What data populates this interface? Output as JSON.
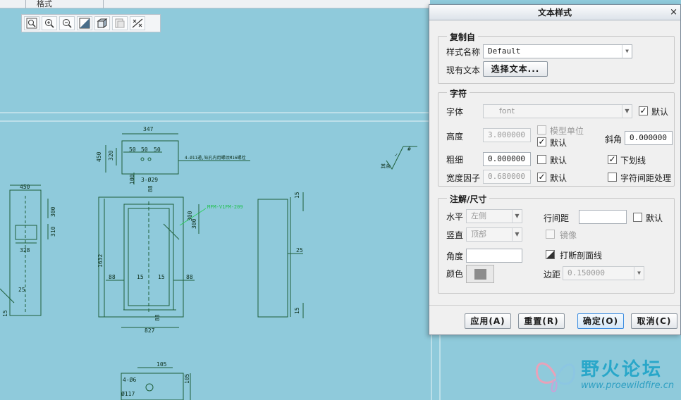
{
  "top_strip": {
    "tab_label": "格式"
  },
  "cad_toolbar": {
    "icons": [
      "zoom-fit-icon",
      "zoom-in-icon",
      "zoom-out-icon",
      "repaint-icon",
      "display-style-icon",
      "sheet-icon",
      "snap-icon"
    ]
  },
  "drawing": {
    "top_view": {
      "dim_347": "347",
      "dim_450": "450",
      "dim_320": "320",
      "dim_50a": "50",
      "dim_50b": "50",
      "dim_50c": "50",
      "dim_100": "100",
      "hole_note": "4-Ø11通,钻孔内用螺纹M16螺栓",
      "hole_note2": "3-Ø29"
    },
    "left_view": {
      "dim_450": "450",
      "dim_300": "300",
      "dim_310": "310",
      "dim_328": "328",
      "dim_25": "25",
      "dim_15": "15"
    },
    "front_view": {
      "dim_88_top": "88",
      "dim_300": "300",
      "dim_1632": "1632",
      "dim_88_l": "88",
      "dim_15a": "15",
      "dim_15b": "15",
      "dim_88_r": "88",
      "dim_827": "827",
      "dim_88_bot": "88",
      "leader_text": "MFM-V1FM-209",
      "dim_300b": "300"
    },
    "right_view": {
      "dim_15a": "15",
      "dim_25": "25",
      "dim_15b": "15"
    },
    "bottom_view": {
      "dim_105": "105",
      "dim_4phi6": "4-Ø6",
      "dim_117": "Ø117",
      "dim_105b": "105"
    },
    "roughness": {
      "sym": "其余",
      "val": "✓",
      "label": "#"
    }
  },
  "dialog": {
    "title": "文本样式",
    "close": "×",
    "copy_from": {
      "title": "复制自",
      "style_name_label": "样式名称",
      "style_name_value": "Default",
      "existing_text_label": "现有文本",
      "select_text_button": "选择文本..."
    },
    "character": {
      "title": "字符",
      "font_label": "字体",
      "font_value": "font",
      "font_default_label": "默认",
      "model_units_label": "模型单位",
      "height_label": "高度",
      "height_value": "3.000000",
      "height_default_label": "默认",
      "slant_label": "斜角",
      "slant_value": "0.000000",
      "thickness_label": "粗细",
      "thickness_value": "0.000000",
      "thickness_default_label": "默认",
      "underline_label": "下划线",
      "width_factor_label": "宽度因子",
      "width_factor_value": "0.680000",
      "width_default_label": "默认",
      "kerning_label": "字符间距处理"
    },
    "note_dim": {
      "title": "注解/尺寸",
      "horizontal_label": "水平",
      "horizontal_value": "左侧",
      "line_spacing_label": "行间距",
      "line_spacing_value": "",
      "line_spacing_default_label": "默认",
      "vertical_label": "竖直",
      "vertical_value": "顶部",
      "mirror_label": "镜像",
      "angle_label": "角度",
      "angle_value": "",
      "break_hatch_label": "打断剖面线",
      "color_label": "颜色",
      "margin_label": "边距",
      "margin_value": "0.150000"
    },
    "buttons": {
      "apply": "应用(A)",
      "reset": "重置(R)",
      "ok": "确定(O)",
      "cancel": "取消(C)"
    },
    "colors": {
      "swatch": "#8c8c8c",
      "ok_border": "#3d8de0"
    }
  },
  "watermark": {
    "cn": "野火论坛",
    "url": "www.proewildfire.cn"
  }
}
